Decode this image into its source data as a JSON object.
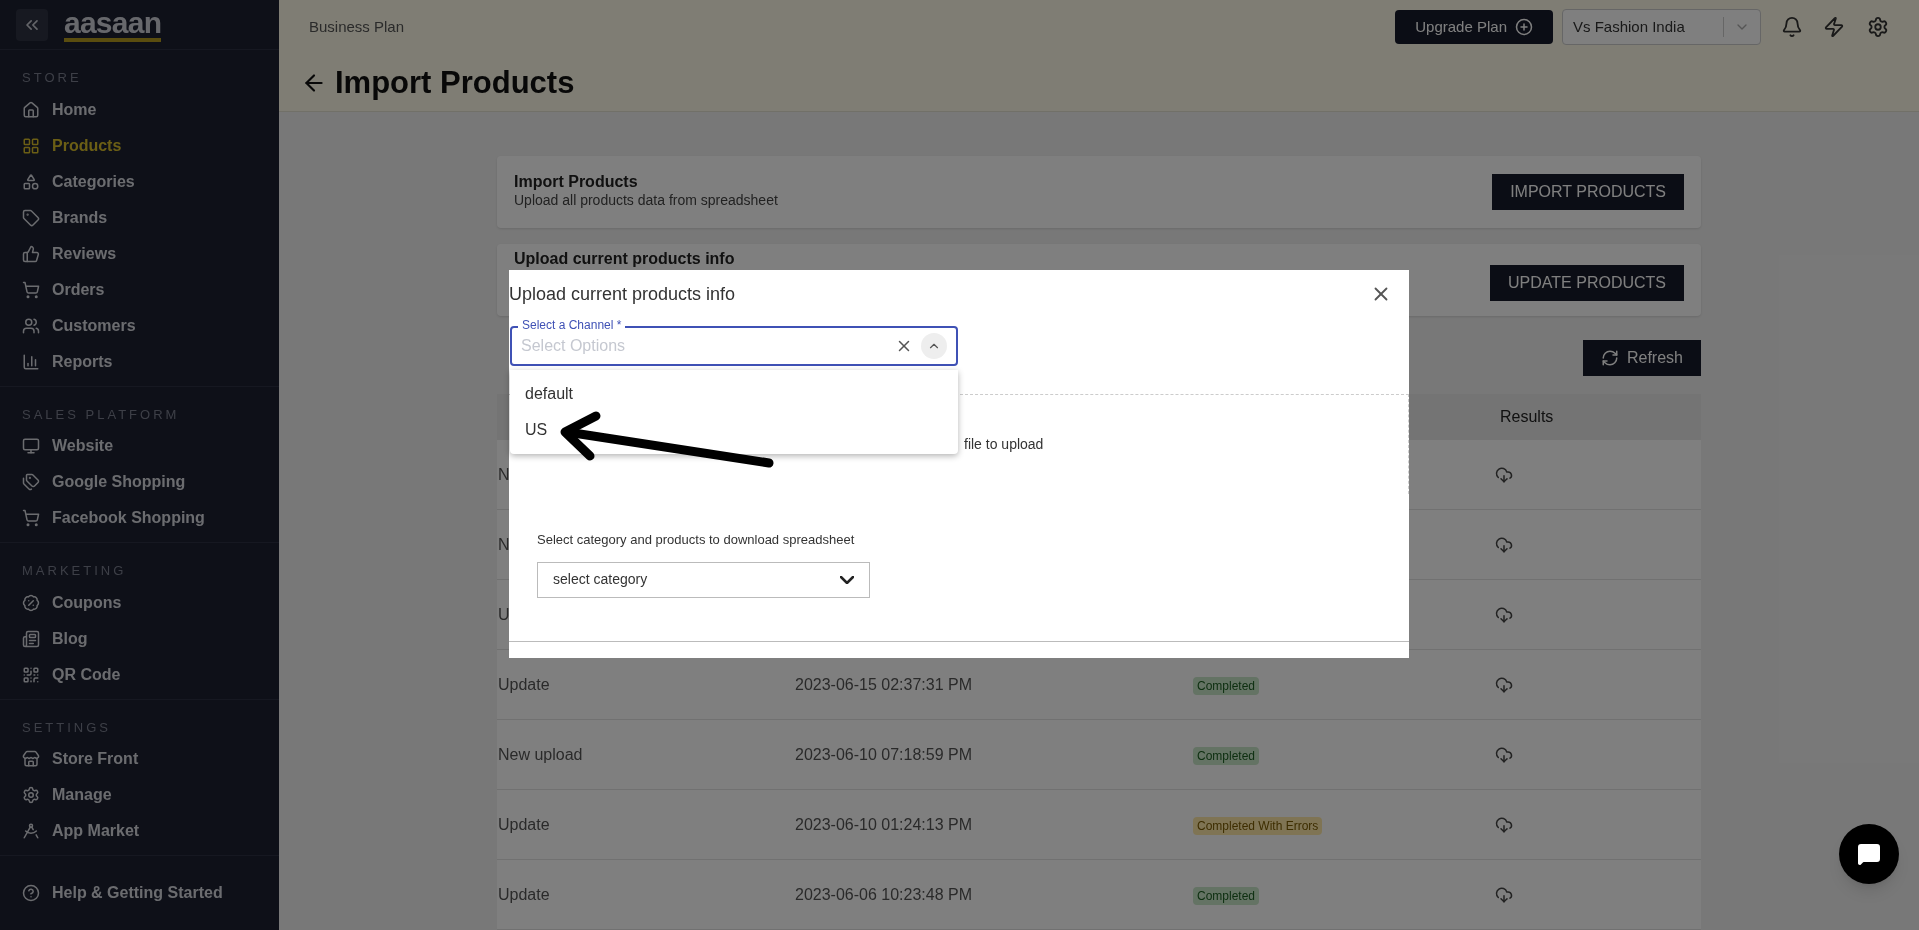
{
  "sidebar": {
    "logo": "aasaan",
    "sections": [
      {
        "label": "STORE",
        "items": [
          {
            "label": "Home",
            "selected": false
          },
          {
            "label": "Products",
            "selected": true
          },
          {
            "label": "Categories",
            "selected": false
          },
          {
            "label": "Brands",
            "selected": false
          },
          {
            "label": "Reviews",
            "selected": false
          },
          {
            "label": "Orders",
            "selected": false
          },
          {
            "label": "Customers",
            "selected": false
          },
          {
            "label": "Reports",
            "selected": false
          }
        ]
      },
      {
        "label": "SALES PLATFORM",
        "items": [
          {
            "label": "Website",
            "selected": false
          },
          {
            "label": "Google Shopping",
            "selected": false
          },
          {
            "label": "Facebook Shopping",
            "selected": false
          }
        ]
      },
      {
        "label": "MARKETING",
        "items": [
          {
            "label": "Coupons",
            "selected": false
          },
          {
            "label": "Blog",
            "selected": false
          },
          {
            "label": "QR Code",
            "selected": false
          }
        ]
      },
      {
        "label": "SETTINGS",
        "items": [
          {
            "label": "Store Front",
            "selected": false
          },
          {
            "label": "Manage",
            "selected": false
          },
          {
            "label": "App Market",
            "selected": false
          }
        ]
      }
    ],
    "footer": "Help & Getting Started"
  },
  "header": {
    "plan": "Business Plan",
    "upgrade_button": "Upgrade Plan",
    "store_select": "Vs Fashion India",
    "title": "Import Products"
  },
  "cards": [
    {
      "title": "Import Products",
      "subtitle": "Upload all products data from spreadsheet",
      "button": "IMPORT PRODUCTS"
    },
    {
      "title": "Upload current products info",
      "button": "UPDATE PRODUCTS"
    }
  ],
  "refresh_button": "Refresh",
  "table": {
    "columns": [
      {
        "label": "Results"
      }
    ],
    "rows": [
      {
        "type": "N"
      },
      {
        "type": "N"
      },
      {
        "type": "U"
      },
      {
        "type": "Update",
        "date": "2023-06-15 02:37:31 PM",
        "status": {
          "text": "Completed",
          "kind": "success"
        }
      },
      {
        "type": "New upload",
        "date": "2023-06-10 07:18:59 PM",
        "status": {
          "text": "Completed",
          "kind": "success"
        }
      },
      {
        "type": "Update",
        "date": "2023-06-10 01:24:13 PM",
        "status": {
          "text": "Completed With Errors",
          "kind": "warning"
        }
      },
      {
        "type": "Update",
        "date": "2023-06-06 10:23:48 PM",
        "status": {
          "text": "Completed",
          "kind": "success"
        }
      }
    ]
  },
  "modal": {
    "title": "Upload current products info",
    "channel_field": {
      "label": "Select a Channel *",
      "placeholder": "Select Options",
      "expanded": true,
      "options": [
        "default",
        "US"
      ]
    },
    "upload_hint": "file to upload",
    "category_label": "Select category and products to download spreadsheet",
    "category_select": "select category"
  }
}
